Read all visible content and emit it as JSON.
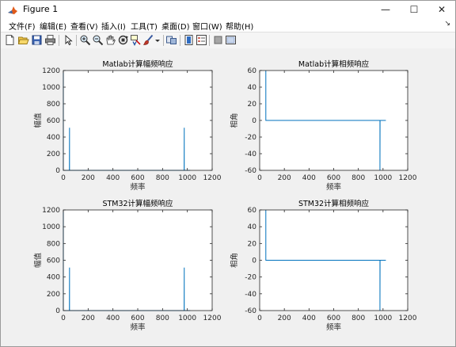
{
  "window": {
    "title": "Figure 1",
    "minimize_glyph": "—",
    "maximize_glyph": "☐",
    "close_glyph": "✕"
  },
  "menu": {
    "items": [
      "文件(F)",
      "编辑(E)",
      "查看(V)",
      "插入(I)",
      "工具(T)",
      "桌面(D)",
      "窗口(W)",
      "帮助(H)"
    ],
    "overflow_glyph": "↘"
  },
  "toolbar": {
    "icons": [
      "new-figure-icon",
      "open-file-icon",
      "save-icon",
      "print-icon",
      "pointer-icon",
      "zoom-in-icon",
      "zoom-out-icon",
      "pan-icon",
      "rotate-3d-icon",
      "data-cursor-icon",
      "brush-icon",
      "link-icon",
      "colorbar-icon",
      "legend-icon",
      "property-editor-icon",
      "plot-browser-icon"
    ]
  },
  "colors": {
    "line": "#0072bd",
    "axes_bg": "#ffffff",
    "figure_bg": "#f0f0f0"
  },
  "chart_data": [
    {
      "type": "line",
      "title": "Matlab计算幅频响应",
      "xlabel": "频率",
      "ylabel": "幅值",
      "xlim": [
        0,
        1200
      ],
      "ylim": [
        0,
        1200
      ],
      "xticks": [
        0,
        200,
        400,
        600,
        800,
        1000,
        1200
      ],
      "yticks": [
        0,
        200,
        400,
        600,
        800,
        1000,
        1200
      ],
      "grid": false,
      "x": [
        0,
        0,
        1,
        49,
        50,
        50,
        51,
        974,
        975,
        975,
        976,
        1023
      ],
      "y": [
        1200,
        0,
        0,
        0,
        512,
        0,
        0,
        0,
        512,
        0,
        0,
        0
      ]
    },
    {
      "type": "line",
      "title": "Matlab计算相频响应",
      "xlabel": "频率",
      "ylabel": "相角",
      "xlim": [
        0,
        1200
      ],
      "ylim": [
        -60,
        60
      ],
      "xticks": [
        0,
        200,
        400,
        600,
        800,
        1000,
        1200
      ],
      "yticks": [
        -60,
        -40,
        -20,
        0,
        20,
        40,
        60
      ],
      "grid": false,
      "x": [
        50,
        50,
        51,
        974,
        975,
        975,
        976,
        1023
      ],
      "y": [
        60,
        0,
        0,
        0,
        0,
        -60,
        0,
        0
      ]
    },
    {
      "type": "line",
      "title": "STM32计算幅频响应",
      "xlabel": "频率",
      "ylabel": "幅值",
      "xlim": [
        0,
        1200
      ],
      "ylim": [
        0,
        1200
      ],
      "xticks": [
        0,
        200,
        400,
        600,
        800,
        1000,
        1200
      ],
      "yticks": [
        0,
        200,
        400,
        600,
        800,
        1000,
        1200
      ],
      "grid": false,
      "x": [
        0,
        0,
        1,
        49,
        50,
        50,
        51,
        974,
        975,
        975,
        976,
        1023
      ],
      "y": [
        1200,
        0,
        0,
        0,
        512,
        0,
        0,
        0,
        512,
        0,
        0,
        0
      ]
    },
    {
      "type": "line",
      "title": "STM32计算相频响应",
      "xlabel": "频率",
      "ylabel": "相角",
      "xlim": [
        0,
        1200
      ],
      "ylim": [
        -60,
        60
      ],
      "xticks": [
        0,
        200,
        400,
        600,
        800,
        1000,
        1200
      ],
      "yticks": [
        -60,
        -40,
        -20,
        0,
        20,
        40,
        60
      ],
      "grid": false,
      "x": [
        50,
        50,
        51,
        974,
        975,
        975,
        976,
        1023
      ],
      "y": [
        60,
        0,
        0,
        0,
        0,
        -60,
        0,
        0
      ]
    }
  ]
}
